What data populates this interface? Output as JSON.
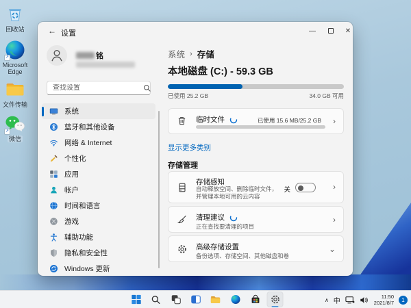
{
  "icons": {
    "back": "←",
    "minimize": "—",
    "close": "✕",
    "chevron_right": "›",
    "chevron_down": "⌄",
    "tray_chevron": "∧",
    "breadcrumb_sep": "›",
    "shortcut_arrow": "↗"
  },
  "desktop": {
    "icons": [
      {
        "label": "回收站"
      },
      {
        "label": "Microsoft Edge"
      },
      {
        "label": "文件传输"
      },
      {
        "label": "微信"
      }
    ]
  },
  "settings_window": {
    "title": "设置",
    "user": {
      "name_suffix": "铭"
    },
    "search_placeholder": "查找设置",
    "sidebar": [
      {
        "label": "系统"
      },
      {
        "label": "蓝牙和其他设备"
      },
      {
        "label": "网络 & Internet"
      },
      {
        "label": "个性化"
      },
      {
        "label": "应用"
      },
      {
        "label": "帐户"
      },
      {
        "label": "时间和语言"
      },
      {
        "label": "游戏"
      },
      {
        "label": "辅助功能"
      },
      {
        "label": "隐私和安全性"
      },
      {
        "label": "Windows 更新"
      }
    ],
    "main": {
      "breadcrumb_parent": "系统",
      "breadcrumb_current": "存储",
      "disk_title": "本地磁盘 (C:) - 59.3 GB",
      "disk_used_label": "已使用 25.2 GB",
      "disk_free_label": "34.0 GB 可用",
      "disk_used_percent": 42.5,
      "temp_files_title": "临时文件",
      "temp_files_usage": "已使用 15.6 MB/25.2 GB",
      "show_more_link": "显示更多类别",
      "section_title": "存储管理",
      "storage_sense_title": "存储感知",
      "storage_sense_desc1": "自动释放空间、删除临时文件，",
      "storage_sense_desc2": "并管理本地可用的云内容",
      "storage_sense_toggle": "关",
      "cleanup_title": "清理建议",
      "cleanup_desc": "正在查找要清理的项目",
      "advanced_title": "高级存储设置",
      "advanced_desc": "备份选项、存储空间、其他磁盘和卷"
    }
  },
  "taskbar": {
    "ime": "中",
    "time": "11:50",
    "date": "2021/8/7",
    "badge": "1"
  }
}
